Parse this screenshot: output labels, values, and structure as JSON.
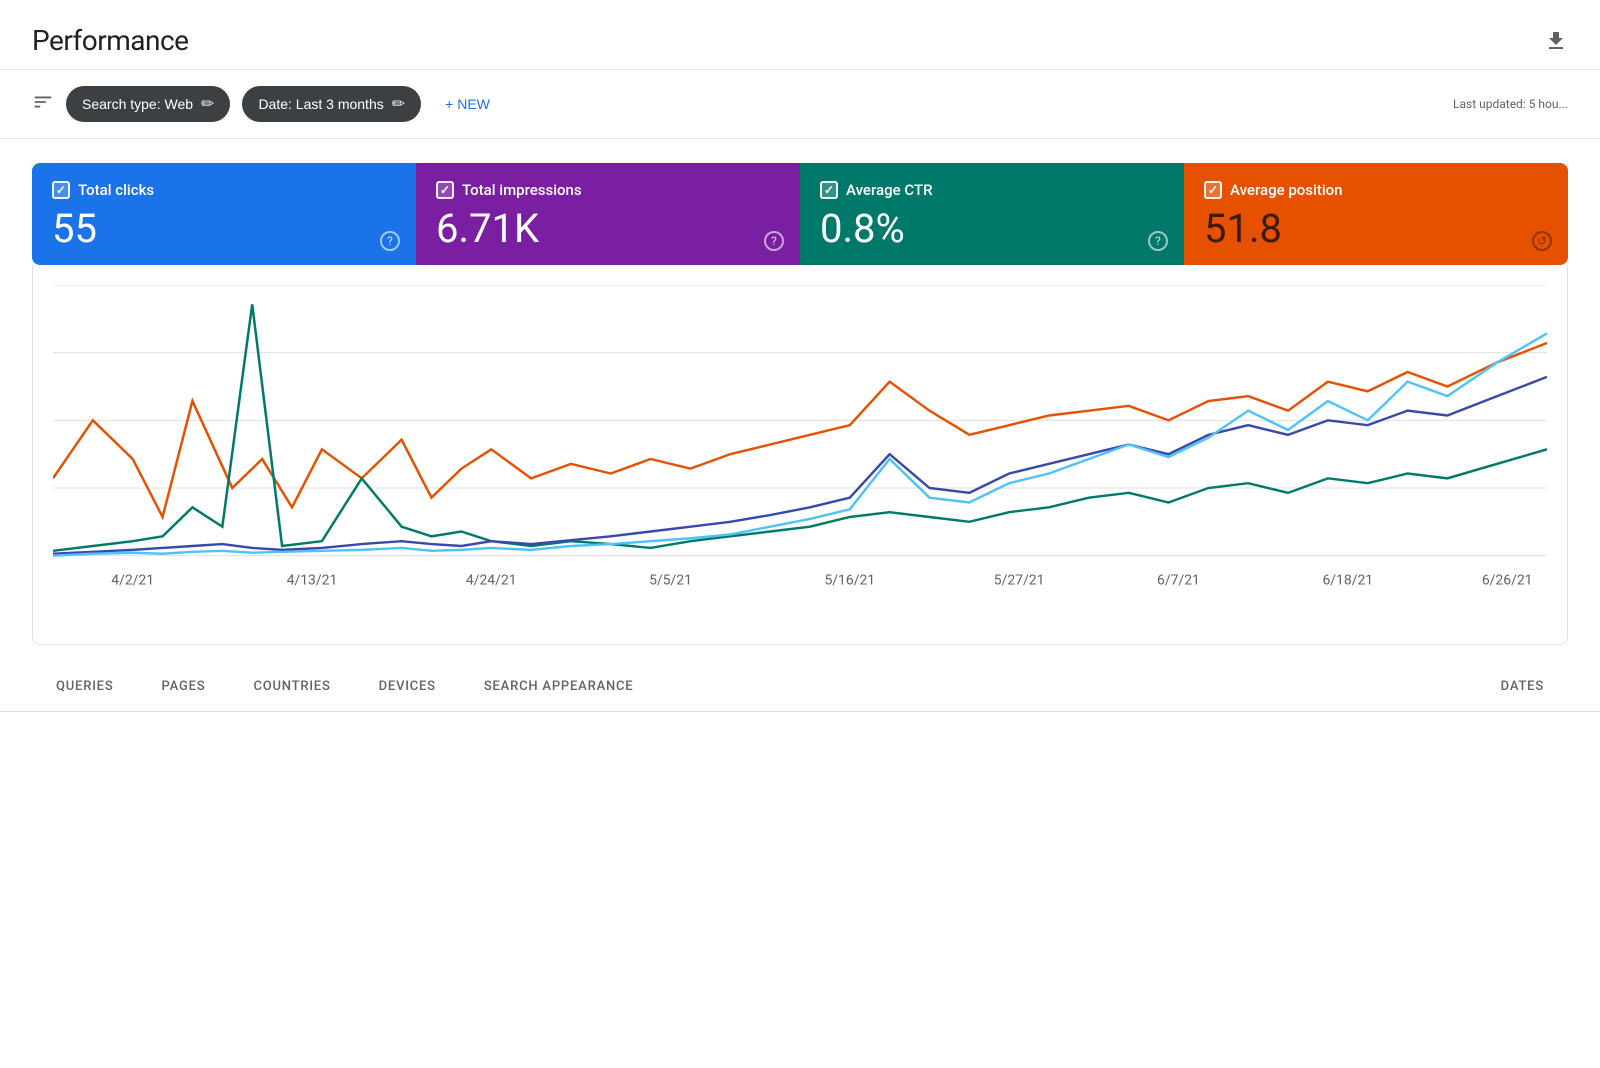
{
  "header": {
    "title": "Performance",
    "download_tooltip": "Download"
  },
  "toolbar": {
    "filter_label": "≡",
    "search_type_chip": "Search type: Web",
    "date_chip": "Date: Last 3 months",
    "new_button": "+ NEW",
    "last_updated": "Last updated: 5 hou..."
  },
  "metrics": [
    {
      "id": "clicks",
      "label": "Total clicks",
      "value": "55",
      "color": "#1a73e8"
    },
    {
      "id": "impressions",
      "label": "Total impressions",
      "value": "6.71K",
      "color": "#7b1fa2"
    },
    {
      "id": "ctr",
      "label": "Average CTR",
      "value": "0.8%",
      "color": "#00796b"
    },
    {
      "id": "position",
      "label": "Average position",
      "value": "51.8",
      "color": "#e65100"
    }
  ],
  "chart": {
    "x_labels": [
      "4/2/21",
      "4/13/21",
      "4/24/21",
      "5/5/21",
      "5/16/21",
      "5/27/21",
      "6/7/21",
      "6/18/21",
      "6/26/21"
    ],
    "series": {
      "clicks_color": "#1a73e8",
      "impressions_color": "#7b1fa2",
      "ctr_color": "#00796b",
      "position_color": "#e65100"
    }
  },
  "bottom_tabs": [
    {
      "id": "queries",
      "label": "QUERIES"
    },
    {
      "id": "pages",
      "label": "PAGES"
    },
    {
      "id": "countries",
      "label": "COUNTRIES"
    },
    {
      "id": "devices",
      "label": "DEVICES"
    },
    {
      "id": "search_appearance",
      "label": "SEARCH APPEARANCE"
    },
    {
      "id": "dates",
      "label": "DATES"
    }
  ]
}
